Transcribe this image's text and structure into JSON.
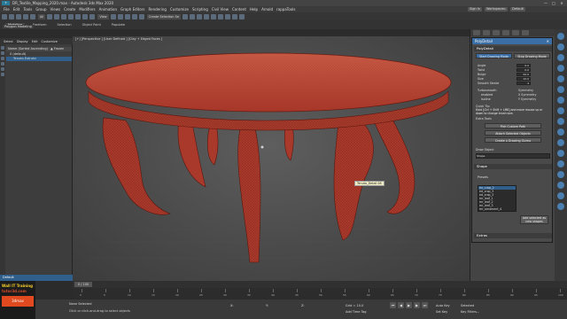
{
  "window": {
    "title": "DR_Textile_Mapping_2020.max - Autodesk 3ds Max 2020",
    "minimize": "—",
    "maximize": "□",
    "close": "✕"
  },
  "menus": [
    "File",
    "Edit",
    "Tools",
    "Group",
    "Views",
    "Create",
    "Modifiers",
    "Animation",
    "Graph Editors",
    "Rendering",
    "Customize",
    "Scripting",
    "Civil View",
    "Content",
    "Help",
    "Arnold",
    "rappaTools"
  ],
  "menubar_right": {
    "signin": "Sign In",
    "workspaces": "Workspaces:",
    "workspace_value": "Default"
  },
  "toolbar": {
    "view_dropdown": "View",
    "selection_set": "Create Selection Se"
  },
  "ribbon": {
    "tabs": [
      "Modeling",
      "Freeform",
      "Selection",
      "Object Paint",
      "Populate"
    ],
    "active_tab": "Modeling",
    "subtitle": "Polygon Modeling"
  },
  "explorer": {
    "tabs": [
      "Select",
      "Display",
      "Edit",
      "Customize"
    ],
    "header_name": "Name (Sorted Ascending)",
    "header_frozen": "▲ Frozen",
    "nodes": [
      "0 (default)",
      "Tenuto Extruto"
    ],
    "layer": "Default"
  },
  "viewport": {
    "label": "[+] [Perspective ] [User Defined ] [Clay + Edged Faces ]",
    "tooltip": "Tenuto_Detail 08"
  },
  "polydetail": {
    "title": "PolyDetail",
    "rollout1": "PolyDetail",
    "start_button": "Start Drawing Mode",
    "stop_button": "Stop Drawing Mode",
    "params": [
      {
        "label": "Angle",
        "value": "0.0"
      },
      {
        "label": "Twist",
        "value": "0.0"
      },
      {
        "label": "Bulge",
        "value": "50.0"
      },
      {
        "label": "Size",
        "value": "10.0"
      },
      {
        "label": "Smooth Stroke",
        "value": "4"
      }
    ],
    "symmetry_header": "Symmetry",
    "turbosmooth_label": "Turbosmooth",
    "enabled_label": "enabled",
    "isoline_label": "isoline",
    "x_symmetry": "X Symmetry",
    "y_symmetry": "Y Symmetry",
    "quick_tip_title": "Quick Tip:",
    "quick_tip_text": "Hold [Ctrl + Shift + LMB] and move mouse up or down to change brush size.",
    "extra_tools": "Extra Tools",
    "extra_buttons": [
      "Pick Custom Path",
      "Attach Selected Objects",
      "Create a Drawing Gizmo"
    ],
    "draw_object_label": "Draw Object",
    "draw_object_value": "Shape",
    "shape_rollout": "Shape",
    "presets_label": "Presets",
    "presets": [
      "mr_crop_2",
      "ed_crop_3",
      "ed_crop_3",
      "mr_leaf_1",
      "mr_leaf_2",
      "mr_leaf_3",
      "mr_ornament_4",
      "ornament_2"
    ],
    "presets_selected_index": 0,
    "add_button": "Add selected as new shapes",
    "extras_rollout": "Extras"
  },
  "timeline": {
    "slider": "0 / 100",
    "ticks": [
      "0",
      "5",
      "10",
      "15",
      "20",
      "25",
      "30",
      "35",
      "40",
      "45",
      "50",
      "55",
      "60",
      "65",
      "70",
      "75",
      "80",
      "85",
      "90",
      "95",
      "100"
    ]
  },
  "status": {
    "line1": "None Selected",
    "line2": "Click or click-and-drag to select objects",
    "x": "X:",
    "y": "Y:",
    "z": "Z:",
    "grid": "Grid = 10.0",
    "autokey": "Auto Key",
    "selected": "Selected",
    "set_key": "Set Key",
    "key_filters": "Key Filters...",
    "add_time_tag": "Add Time Tag"
  },
  "brand": {
    "line1": "Wall IT Training",
    "line2": "tutor3d.com",
    "badge": "3dmax"
  },
  "colors": {
    "accent": "#3a6ea5",
    "model": "#b8402f",
    "selection": "#2f5f8a"
  }
}
